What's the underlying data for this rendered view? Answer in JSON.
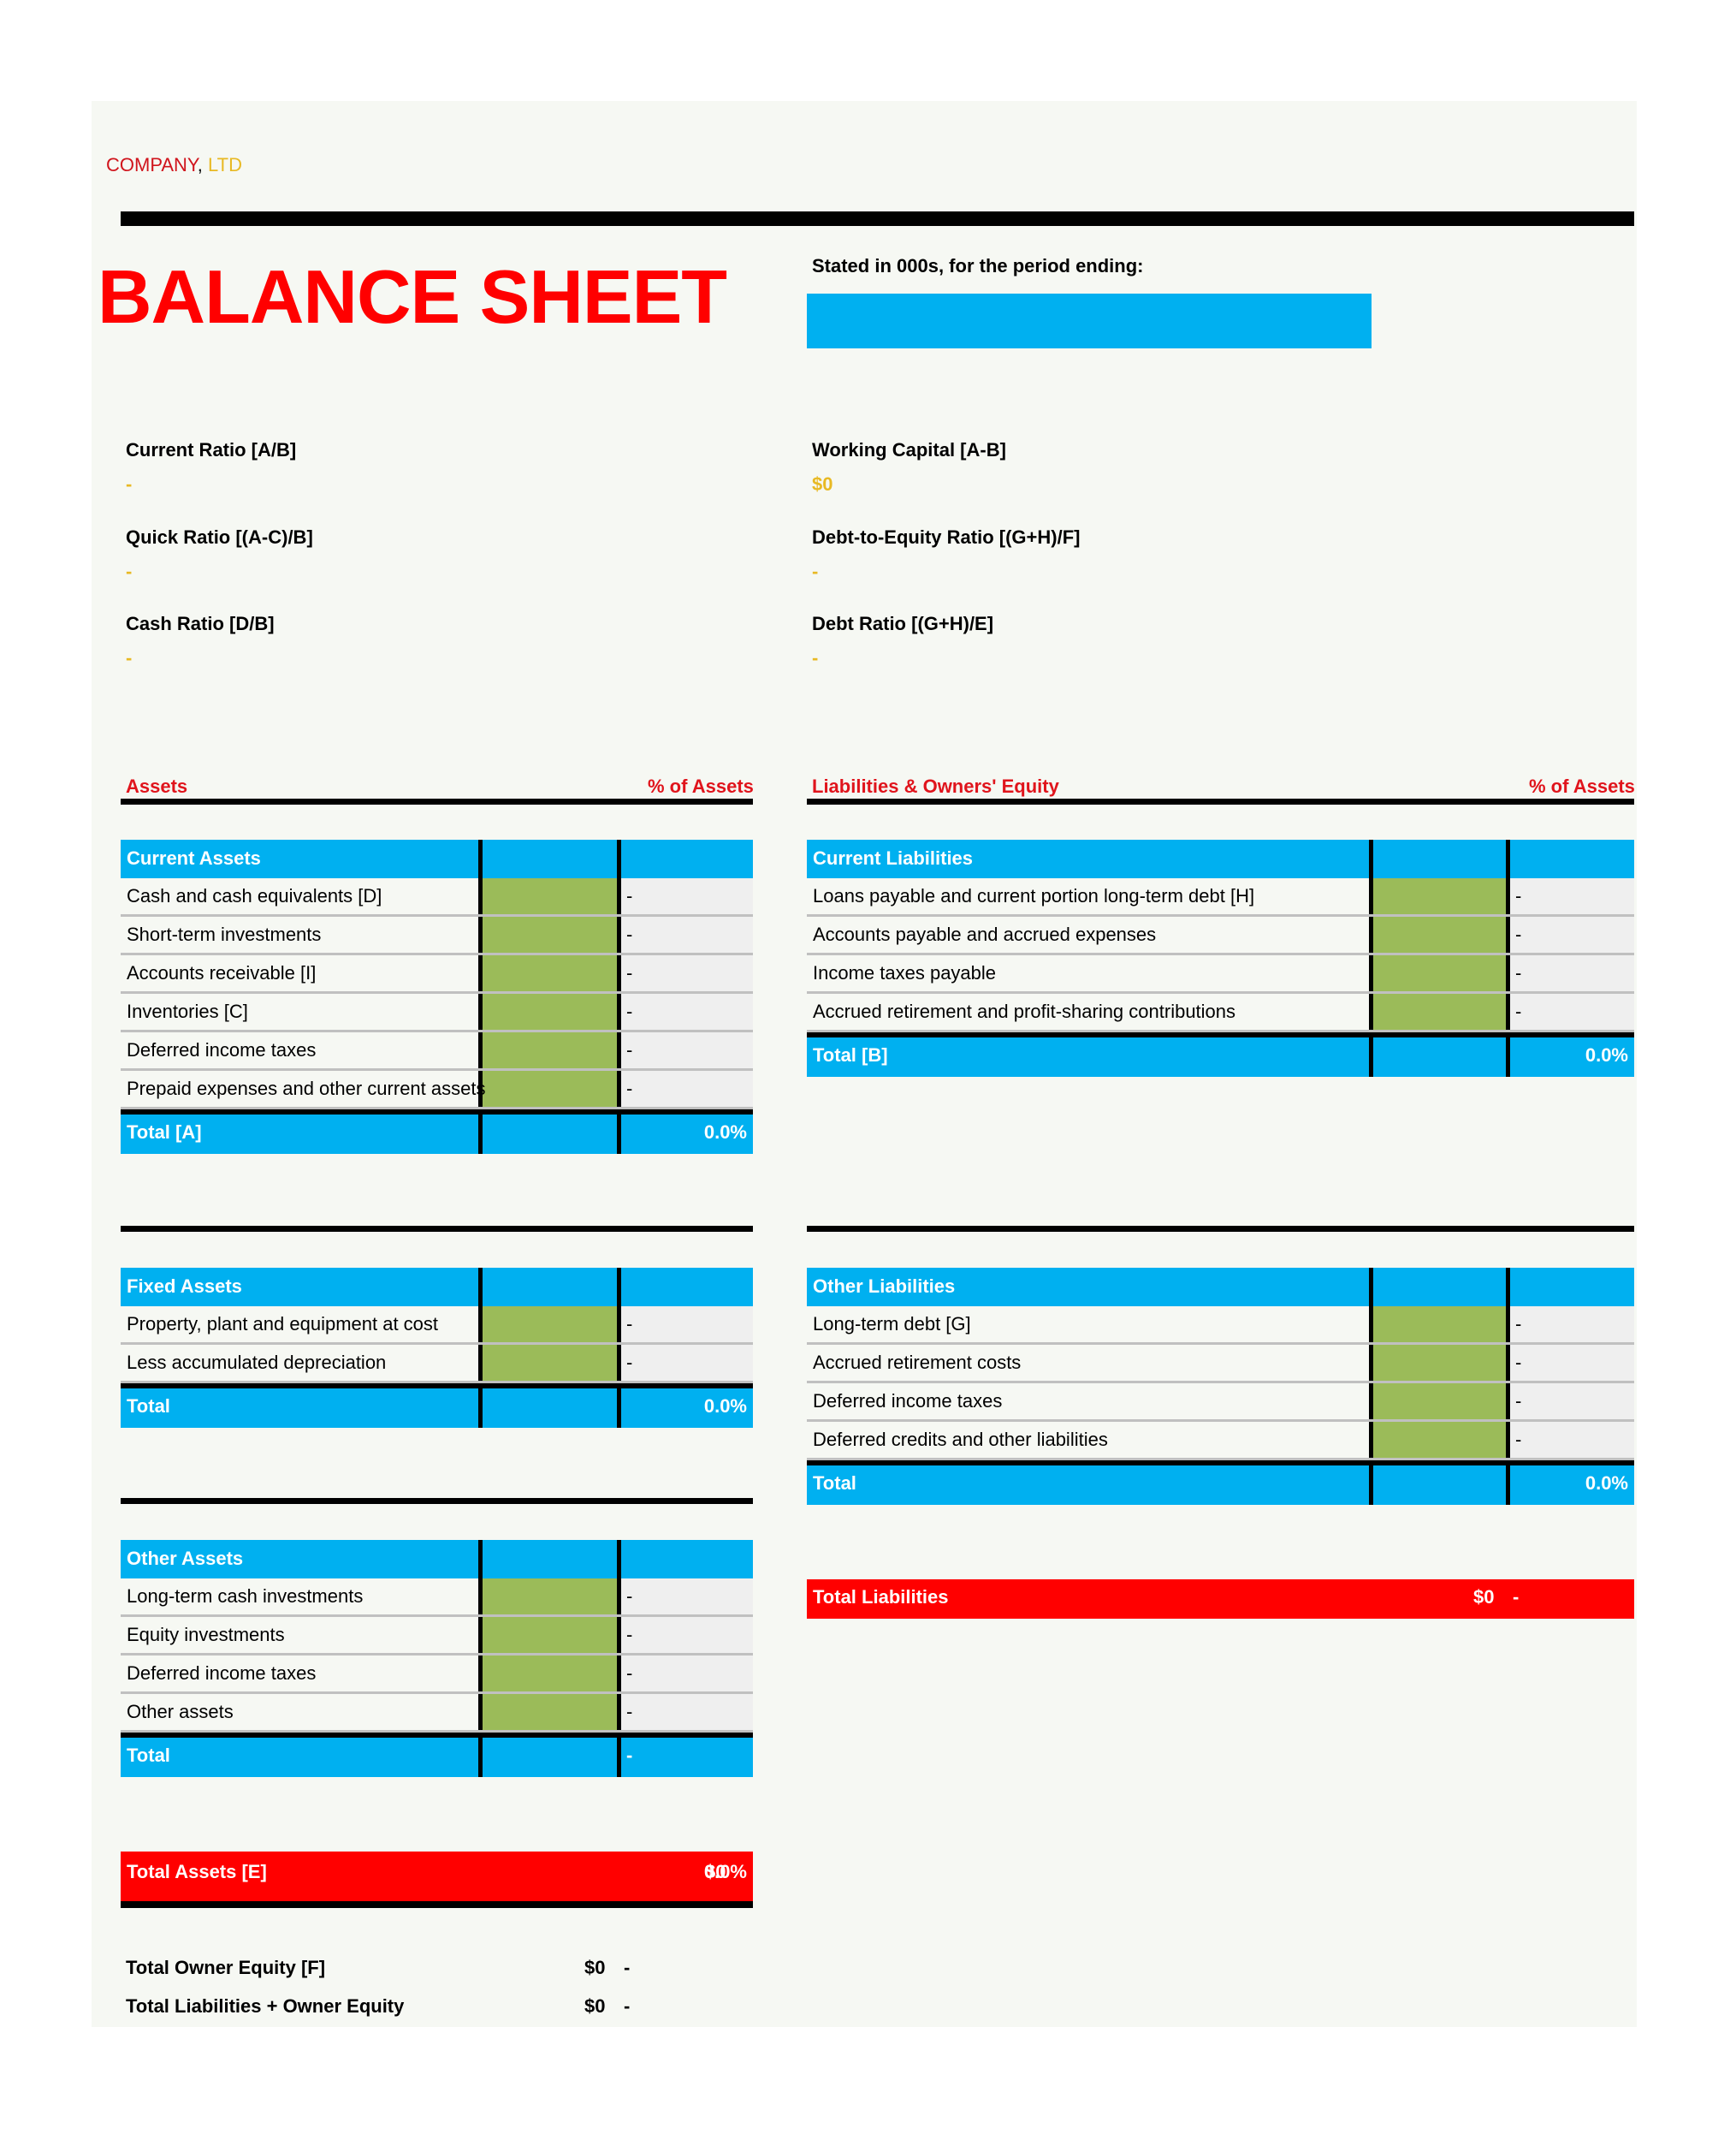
{
  "header": {
    "company_name": "COMPANY",
    "company_sep": ",",
    "company_suffix": "LTD",
    "title": "BALANCE SHEET",
    "stated_label": "Stated in 000s, for the period ending:",
    "period_value": ""
  },
  "colors": {
    "accent_blue": "#00b0f0",
    "input_green": "#9bbb59",
    "total_red": "#ff0000",
    "heading_red": "#e0141c",
    "value_gold": "#e8b923"
  },
  "ratios": {
    "left": [
      {
        "label": "Current Ratio   [A/B]",
        "value": "-"
      },
      {
        "label": "Quick Ratio   [(A-C)/B]",
        "value": "-"
      },
      {
        "label": "Cash Ratio   [D/B]",
        "value": "-"
      }
    ],
    "right": [
      {
        "label": "Working Capital   [A-B]",
        "value": "$0"
      },
      {
        "label": "Debt-to-Equity Ratio   [(G+H)/F]",
        "value": "-"
      },
      {
        "label": "Debt Ratio   [(G+H)/E]",
        "value": "-"
      }
    ]
  },
  "assets": {
    "heading": "Assets",
    "pct_heading": "% of Assets",
    "current": {
      "title": "Current Assets",
      "rows": [
        {
          "label": "Cash and cash equivalents   [D]",
          "value": "",
          "pct": "-"
        },
        {
          "label": "Short-term investments",
          "value": "",
          "pct": "-"
        },
        {
          "label": "Accounts receivable   [I]",
          "value": "",
          "pct": "-"
        },
        {
          "label": "Inventories   [C]",
          "value": "",
          "pct": "-"
        },
        {
          "label": "Deferred income taxes",
          "value": "",
          "pct": "-"
        },
        {
          "label": "Prepaid expenses and other current assets",
          "value": "",
          "pct": "-"
        }
      ],
      "total_label": "Total   [A]",
      "total_value": "",
      "total_pct": "0.0%"
    },
    "fixed": {
      "title": "Fixed Assets",
      "rows": [
        {
          "label": "Property, plant and equipment at cost",
          "value": "",
          "pct": "-"
        },
        {
          "label": "Less accumulated depreciation",
          "value": "",
          "pct": "-"
        }
      ],
      "total_label": "Total",
      "total_value": "",
      "total_pct": "0.0%"
    },
    "other": {
      "title": "Other Assets",
      "rows": [
        {
          "label": "Long-term cash investments",
          "value": "",
          "pct": "-"
        },
        {
          "label": "Equity investments",
          "value": "",
          "pct": "-"
        },
        {
          "label": "Deferred income taxes",
          "value": "",
          "pct": "-"
        },
        {
          "label": "Other assets",
          "value": "",
          "pct": "-"
        }
      ],
      "total_label": "Total",
      "total_value": "",
      "total_pct": "-"
    },
    "total_assets": {
      "label": "Total Assets   [E]",
      "value": "$0",
      "pct": "0.0%"
    }
  },
  "liabilities": {
    "heading": "Liabilities & Owners' Equity",
    "pct_heading": "% of Assets",
    "current": {
      "title": "Current Liabilities",
      "rows": [
        {
          "label": "Loans payable and current portion long-term debt   [H]",
          "value": "",
          "pct": "-"
        },
        {
          "label": "Accounts payable and accrued expenses",
          "value": "",
          "pct": "-"
        },
        {
          "label": "Income taxes payable",
          "value": "",
          "pct": "-"
        },
        {
          "label": "Accrued retirement and profit-sharing contributions",
          "value": "",
          "pct": "-"
        }
      ],
      "total_label": "Total   [B]",
      "total_value": "",
      "total_pct": "0.0%"
    },
    "other": {
      "title": "Other Liabilities",
      "rows": [
        {
          "label": "Long-term debt   [G]",
          "value": "",
          "pct": "-"
        },
        {
          "label": "Accrued retirement costs",
          "value": "",
          "pct": "-"
        },
        {
          "label": "Deferred income taxes",
          "value": "",
          "pct": "-"
        },
        {
          "label": "Deferred credits and other liabilities",
          "value": "",
          "pct": "-"
        }
      ],
      "total_label": "Total",
      "total_value": "",
      "total_pct": "0.0%"
    },
    "total_liabilities": {
      "label": "Total Liabilities",
      "value": "$0",
      "pct": "-"
    }
  },
  "summary": {
    "owner_equity": {
      "label": "Total Owner Equity   [F]",
      "value": "$0",
      "pct": "-"
    },
    "liabilities_plus_equity": {
      "label": "Total Liabilities + Owner Equity",
      "value": "$0",
      "pct": "-"
    }
  }
}
